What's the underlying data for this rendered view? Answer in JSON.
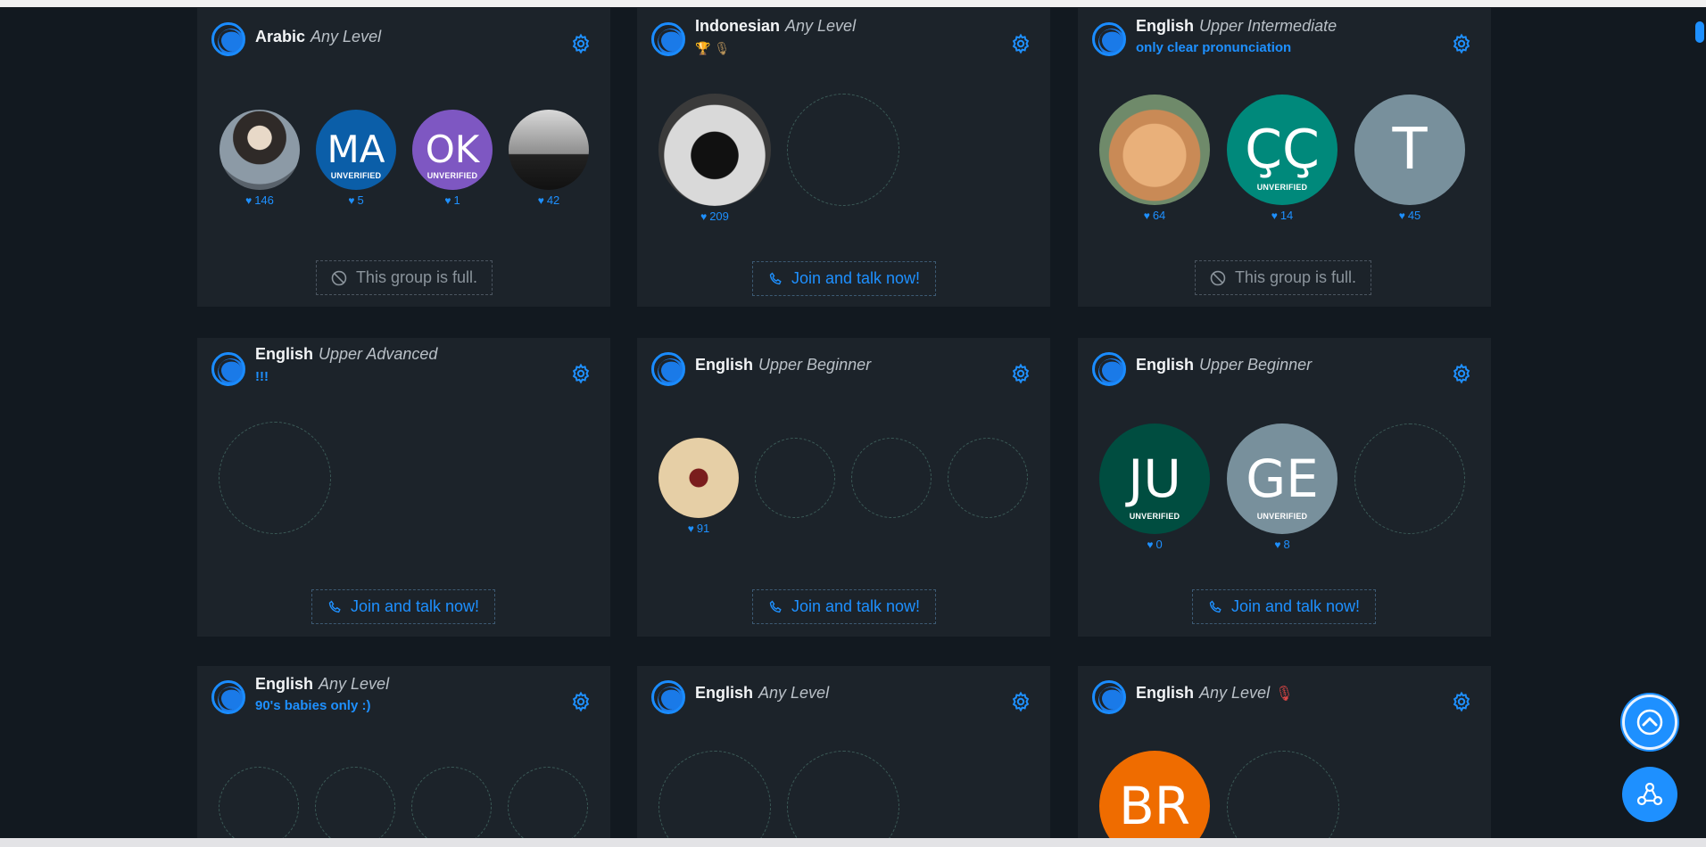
{
  "colors": {
    "accent": "#1e90ff",
    "card_bg": "#1c232a",
    "page_bg": "#121920"
  },
  "cards": [
    {
      "language": "Arabic",
      "level": "Any Level",
      "members": [
        {
          "initials": "",
          "likes": "146",
          "photo": "person-photo"
        },
        {
          "initials": "MA",
          "unverified": "UNVERIFIED",
          "likes": "5",
          "color": "#0b5ea8"
        },
        {
          "initials": "OK",
          "unverified": "UNVERIFIED",
          "likes": "1",
          "color": "#7e57c2"
        },
        {
          "initials": "",
          "likes": "42",
          "photo": "silhouette-photo"
        }
      ],
      "action": "This group is full."
    },
    {
      "language": "Indonesian",
      "level": "Any Level",
      "badges": "🏆 🎙",
      "members": [
        {
          "initials": "",
          "likes": "209",
          "photo": "hooded-photo"
        }
      ],
      "action": "Join and talk now!"
    },
    {
      "language": "English",
      "level": "Upper Intermediate",
      "topic": "only clear pronunciation",
      "members": [
        {
          "initials": "",
          "likes": "64",
          "photo": "rabbit-photo"
        },
        {
          "initials": "ÇÇ",
          "unverified": "UNVERIFIED",
          "likes": "14",
          "color": "#00897b"
        },
        {
          "initials": "T",
          "likes": "45",
          "color": "#78909c"
        }
      ],
      "action": "This group is full."
    },
    {
      "language": "English",
      "level": "Upper Advanced",
      "topic": "!!!",
      "members": [],
      "action": "Join and talk now!"
    },
    {
      "language": "English",
      "level": "Upper Beginner",
      "members": [
        {
          "initials": "",
          "likes": "91",
          "photo": "calligraphy-photo"
        }
      ],
      "action": "Join and talk now!"
    },
    {
      "language": "English",
      "level": "Upper Beginner",
      "members": [
        {
          "initials": "JU",
          "unverified": "UNVERIFIED",
          "likes": "0",
          "color": "#004d40"
        },
        {
          "initials": "GE",
          "unverified": "UNVERIFIED",
          "likes": "8",
          "color": "#78909c"
        }
      ],
      "action": "Join and talk now!"
    },
    {
      "language": "English",
      "level": "Any Level",
      "topic": "90's babies only :)",
      "members": []
    },
    {
      "language": "English",
      "level": "Any Level",
      "members": []
    },
    {
      "language": "English",
      "level": "Any Level",
      "mic_icon": "mic-muted-icon",
      "members": [
        {
          "initials": "BR",
          "color": "#ef6c00"
        }
      ]
    }
  ],
  "icons": {
    "gear": "gear-icon",
    "phone": "phone-icon",
    "ban": "ban-icon",
    "heart": "heart-icon",
    "scroll_top": "chevron-up-icon",
    "share": "share-icon"
  }
}
